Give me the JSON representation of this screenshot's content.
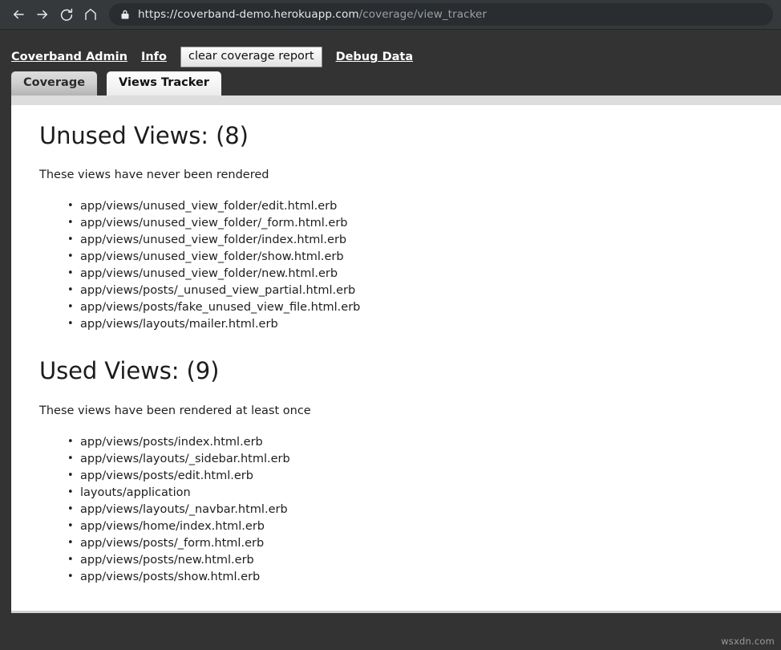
{
  "browser": {
    "back_icon": "back-arrow-icon",
    "forward_icon": "forward-arrow-icon",
    "reload_icon": "reload-icon",
    "home_icon": "home-icon",
    "lock_icon": "lock-icon",
    "url_secure_part": "https://coverband-demo.herokuapp.com",
    "url_path_part": "/coverage/view_tracker",
    "chrome_bg": "#35393c",
    "urlbar_bg": "#292d30"
  },
  "app_nav": {
    "brand_label": "Coverband Admin",
    "info_label": "Info",
    "clear_button_label": "clear coverage report",
    "debug_label": "Debug Data"
  },
  "tabs": [
    {
      "label": "Coverage",
      "active": false
    },
    {
      "label": "Views Tracker",
      "active": true
    }
  ],
  "sections": [
    {
      "title": "Unused Views: (8)",
      "description": "These views have never been rendered",
      "count": 8,
      "items": [
        "app/views/unused_view_folder/edit.html.erb",
        "app/views/unused_view_folder/_form.html.erb",
        "app/views/unused_view_folder/index.html.erb",
        "app/views/unused_view_folder/show.html.erb",
        "app/views/unused_view_folder/new.html.erb",
        "app/views/posts/_unused_view_partial.html.erb",
        "app/views/posts/fake_unused_view_file.html.erb",
        "app/views/layouts/mailer.html.erb"
      ]
    },
    {
      "title": "Used Views: (9)",
      "description": "These views have been rendered at least once",
      "count": 9,
      "items": [
        "app/views/posts/index.html.erb",
        "app/views/layouts/_sidebar.html.erb",
        "app/views/posts/edit.html.erb",
        "layouts/application",
        "app/views/layouts/_navbar.html.erb",
        "app/views/home/index.html.erb",
        "app/views/posts/_form.html.erb",
        "app/views/posts/new.html.erb",
        "app/views/posts/show.html.erb"
      ]
    }
  ],
  "watermark": "wsxdn.com",
  "colors": {
    "page_bg": "#333333",
    "panel_bg": "#ffffff",
    "panel_top_strip": "#dddddd",
    "text": "#1f1f1f"
  }
}
